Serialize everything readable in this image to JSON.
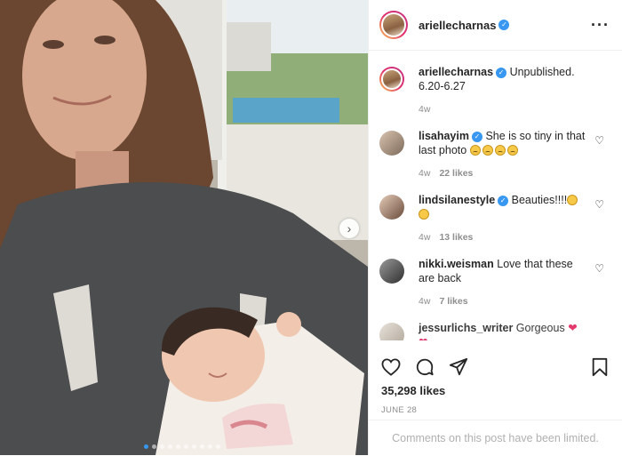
{
  "post": {
    "author": "ariellecharnas",
    "caption_text": "Unpublished. 6.20-6.27",
    "caption_age": "4w",
    "total_likes": "35,298 likes",
    "date": "JUNE 28",
    "comments_limited": "Comments on this post have been limited.",
    "carousel": {
      "count": 10,
      "active_index": 0
    }
  },
  "comments": [
    {
      "user": "lisahayim",
      "verified": true,
      "text": "She is so tiny in that last photo",
      "emoji_count": 4,
      "age": "4w",
      "likes": "22 likes"
    },
    {
      "user": "lindsilanestyle",
      "verified": true,
      "text": "Beauties!!!!",
      "emoji_count": 2,
      "age": "4w",
      "likes": "13 likes"
    },
    {
      "user": "nikki.weisman",
      "verified": false,
      "text": "Love that these are back",
      "emoji_count": 0,
      "age": "4w",
      "likes": "7 likes"
    },
    {
      "user": "jessurlichs_writer",
      "verified": false,
      "text": "Gorgeous",
      "emoji_count": 2,
      "age": "",
      "likes": ""
    }
  ],
  "icons": {
    "heart": "heart-icon",
    "comment": "comment-icon",
    "share": "share-icon",
    "save": "bookmark-icon",
    "more": "more-options-icon",
    "verified": "verified-badge-icon"
  },
  "colors": {
    "verified": "#3897f0",
    "secondary_text": "#8e8e8e",
    "border": "#efefef"
  }
}
